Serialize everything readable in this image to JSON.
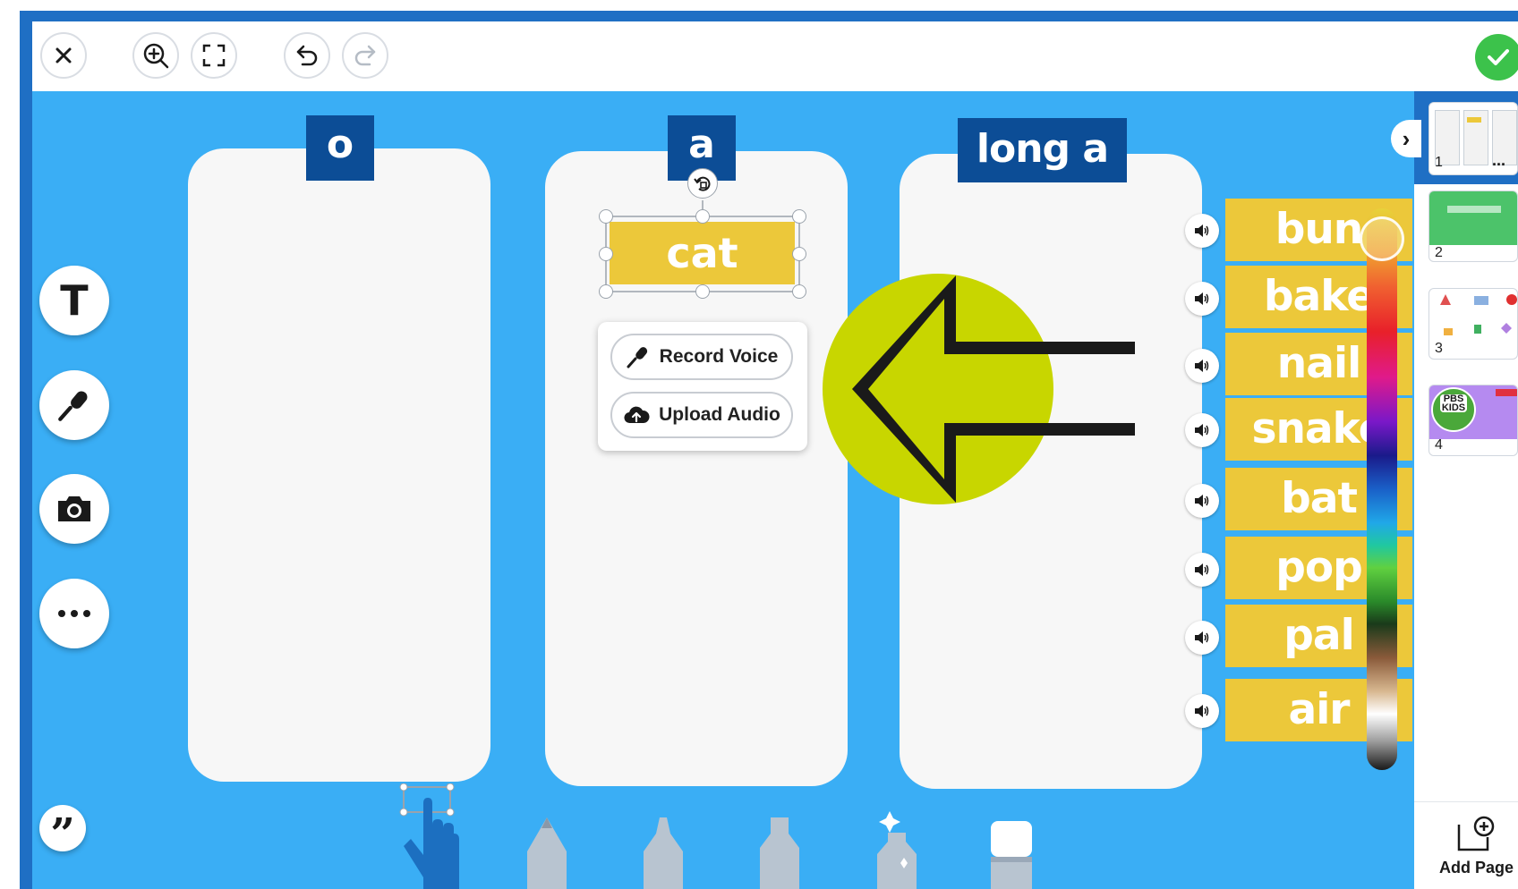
{
  "toolbar": {
    "close": "close",
    "zoom_in": "zoom-in",
    "fullscreen": "fullscreen",
    "undo": "undo",
    "redo": "redo",
    "done": "done"
  },
  "columns": [
    {
      "header": "o"
    },
    {
      "header": "a"
    },
    {
      "header": "long a"
    }
  ],
  "selected_card": {
    "label": "cat"
  },
  "audio_menu": {
    "record_label": "Record Voice",
    "upload_label": "Upload Audio"
  },
  "word_cards": [
    "bun",
    "bake",
    "nail",
    "snake",
    "bat",
    "pop",
    "pal",
    "air"
  ],
  "pages_panel": {
    "pages": [
      {
        "number": "1",
        "more": "..."
      },
      {
        "number": "2"
      },
      {
        "number": "3"
      },
      {
        "number": "4",
        "logo_text": "PBS KIDS"
      }
    ],
    "add_page_label": "Add Page"
  },
  "colors": {
    "canvas_bg": "#3aaef5",
    "header_bg": "#0c4d96",
    "word_card": "#ecc83a",
    "arrow_circle": "#c8d600",
    "done_green": "#3cc24b"
  }
}
